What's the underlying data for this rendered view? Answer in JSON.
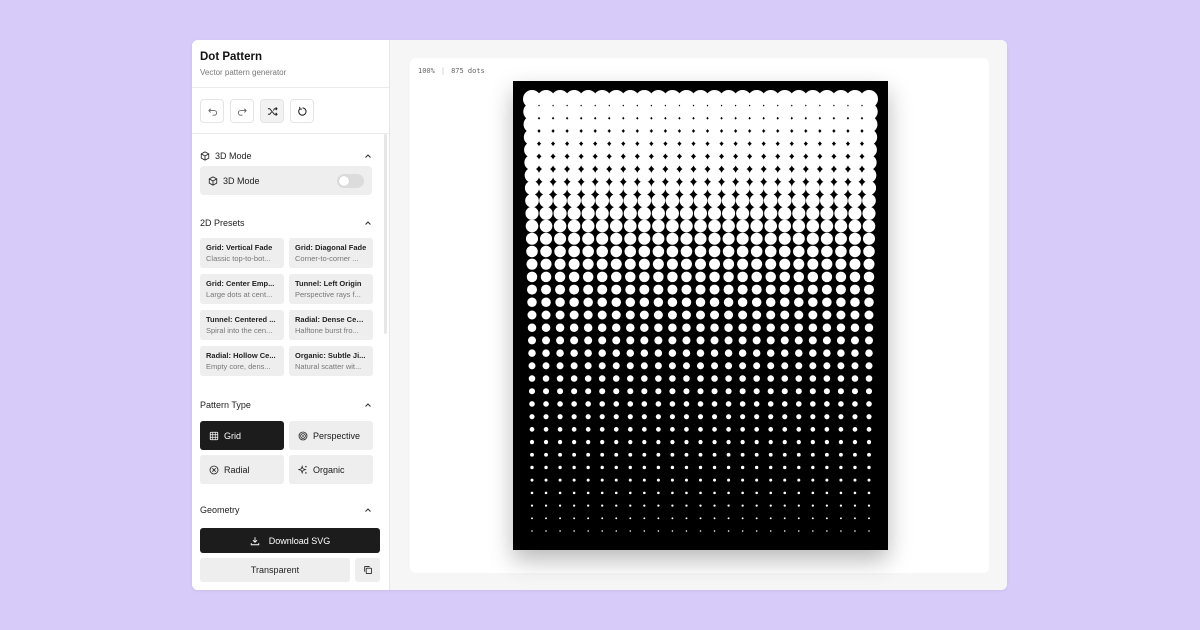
{
  "app": {
    "title": "Dot Pattern",
    "subtitle": "Vector pattern generator"
  },
  "toolbar": {
    "undo_icon": "undo-icon",
    "redo_icon": "redo-icon",
    "shuffle_icon": "shuffle-icon",
    "reset_icon": "reset-icon"
  },
  "sections": {
    "mode3d": {
      "title": "3D Mode",
      "toggle_label": "3D Mode",
      "toggle_on": false
    },
    "presets": {
      "title": "2D Presets",
      "items": [
        {
          "name": "Grid: Vertical Fade",
          "desc": "Classic top-to-bot..."
        },
        {
          "name": "Grid: Diagonal Fade",
          "desc": "Corner-to-corner ..."
        },
        {
          "name": "Grid: Center Emp...",
          "desc": "Large dots at cent..."
        },
        {
          "name": "Tunnel: Left Origin",
          "desc": "Perspective rays f..."
        },
        {
          "name": "Tunnel: Centered ...",
          "desc": "Spiral into the cen..."
        },
        {
          "name": "Radial: Dense Cen...",
          "desc": "Halftone burst fro..."
        },
        {
          "name": "Radial: Hollow Ce...",
          "desc": "Empty core, dens..."
        },
        {
          "name": "Organic: Subtle Ji...",
          "desc": "Natural scatter wit..."
        }
      ]
    },
    "pattern_type": {
      "title": "Pattern Type",
      "selected": "Grid",
      "options": [
        "Grid",
        "Perspective",
        "Radial",
        "Organic"
      ]
    },
    "geometry": {
      "title": "Geometry"
    }
  },
  "footer": {
    "download_label": "Download SVG",
    "background_label": "Transparent"
  },
  "canvas": {
    "zoom": "100%",
    "dot_count": "875 dots",
    "grid_cols": 25,
    "grid_rows": 35,
    "background_color": "#000000",
    "dot_color": "#ffffff"
  }
}
